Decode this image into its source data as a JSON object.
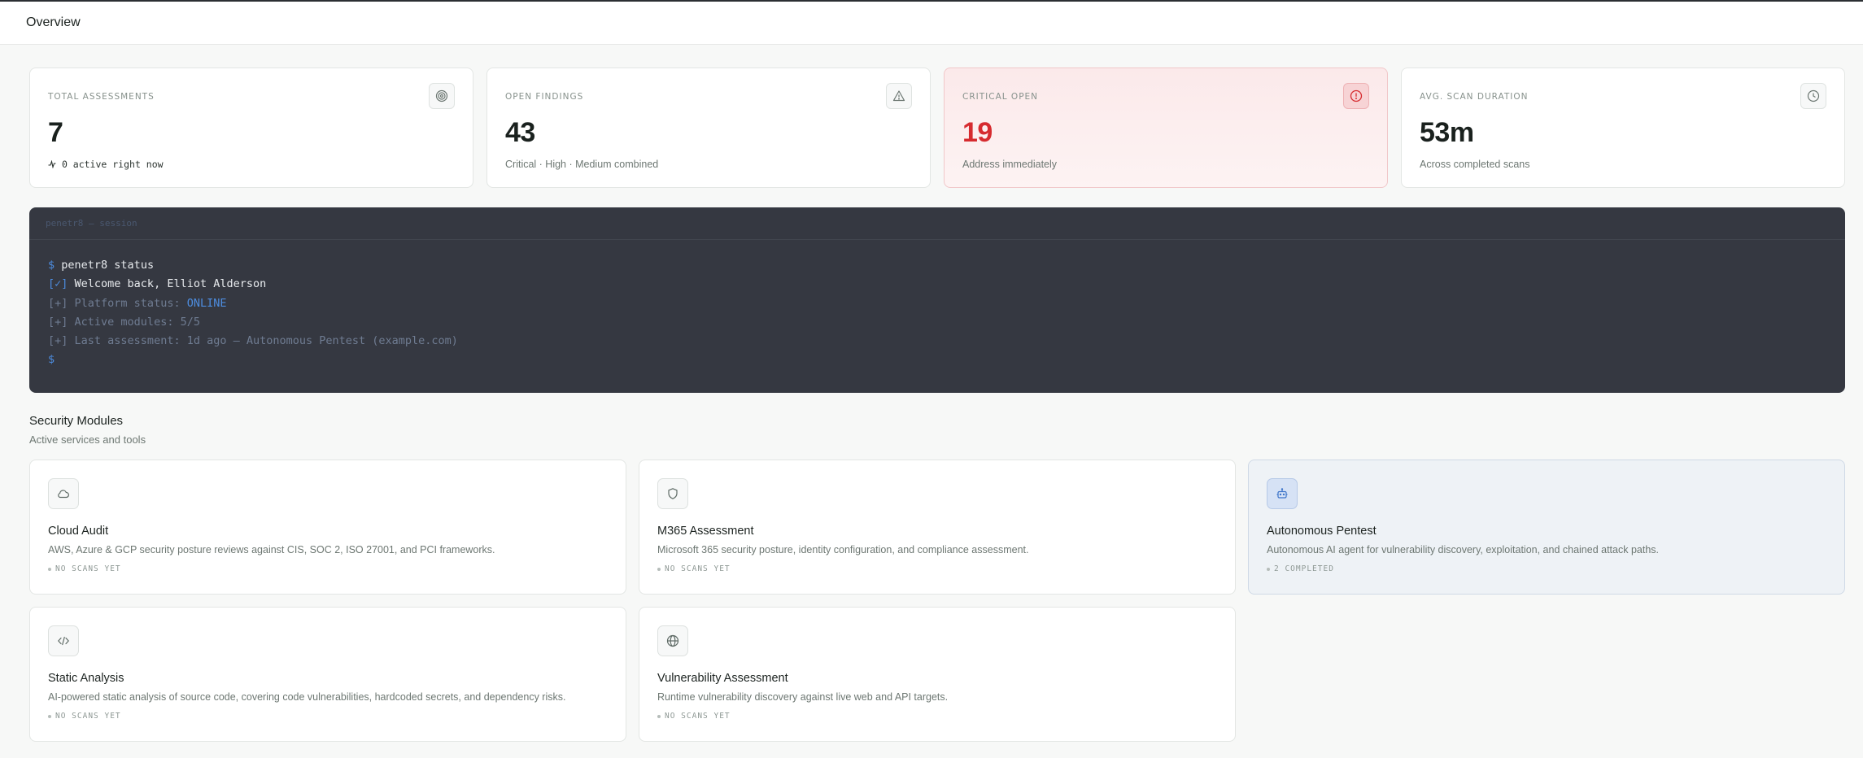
{
  "header": {
    "title": "Overview"
  },
  "stats": [
    {
      "label": "TOTAL ASSESSMENTS",
      "value": "7",
      "sub": "0 active right now",
      "icon": "target-icon"
    },
    {
      "label": "OPEN FINDINGS",
      "value": "43",
      "sub": "Critical · High · Medium combined",
      "icon": "warning-icon"
    },
    {
      "label": "CRITICAL OPEN",
      "value": "19",
      "sub": "Address immediately",
      "icon": "alert-circle-icon"
    },
    {
      "label": "AVG. SCAN DURATION",
      "value": "53m",
      "sub": "Across completed scans",
      "icon": "clock-icon"
    }
  ],
  "terminal": {
    "title": "penetr8 — session",
    "prompt": "$",
    "command": "penetr8 status",
    "lines": [
      {
        "prefix": "[✓]",
        "text": "Welcome back, Elliot Alderson"
      },
      {
        "prefix": "[+]",
        "text": "Platform status: ",
        "highlight": "ONLINE"
      },
      {
        "prefix": "[+]",
        "text": "Active modules: 5/5"
      },
      {
        "prefix": "[+]",
        "text": "Last assessment: 1d ago — Autonomous Pentest (example.com)"
      }
    ]
  },
  "modules_section": {
    "title": "Security Modules",
    "subtitle": "Active services and tools"
  },
  "modules": [
    {
      "title": "Cloud Audit",
      "desc": "AWS, Azure & GCP security posture reviews against CIS, SOC 2, ISO 27001, and PCI frameworks.",
      "status": "NO SCANS YET",
      "icon": "cloud-icon"
    },
    {
      "title": "M365 Assessment",
      "desc": "Microsoft 365 security posture, identity configuration, and compliance assessment.",
      "status": "NO SCANS YET",
      "icon": "shield-icon"
    },
    {
      "title": "Autonomous Pentest",
      "desc": "Autonomous AI agent for vulnerability discovery, exploitation, and chained attack paths.",
      "status": "2 COMPLETED",
      "icon": "robot-icon"
    },
    {
      "title": "Static Analysis",
      "desc": "AI-powered static analysis of source code, covering code vulnerabilities, hardcoded secrets, and dependency risks.",
      "status": "NO SCANS YET",
      "icon": "code-icon"
    },
    {
      "title": "Vulnerability Assessment",
      "desc": "Runtime vulnerability discovery against live web and API targets.",
      "status": "NO SCANS YET",
      "icon": "globe-icon"
    }
  ],
  "colors": {
    "critical": "#d62b2f",
    "terminal_bg": "#353841",
    "terminal_accent": "#4d8de0"
  }
}
